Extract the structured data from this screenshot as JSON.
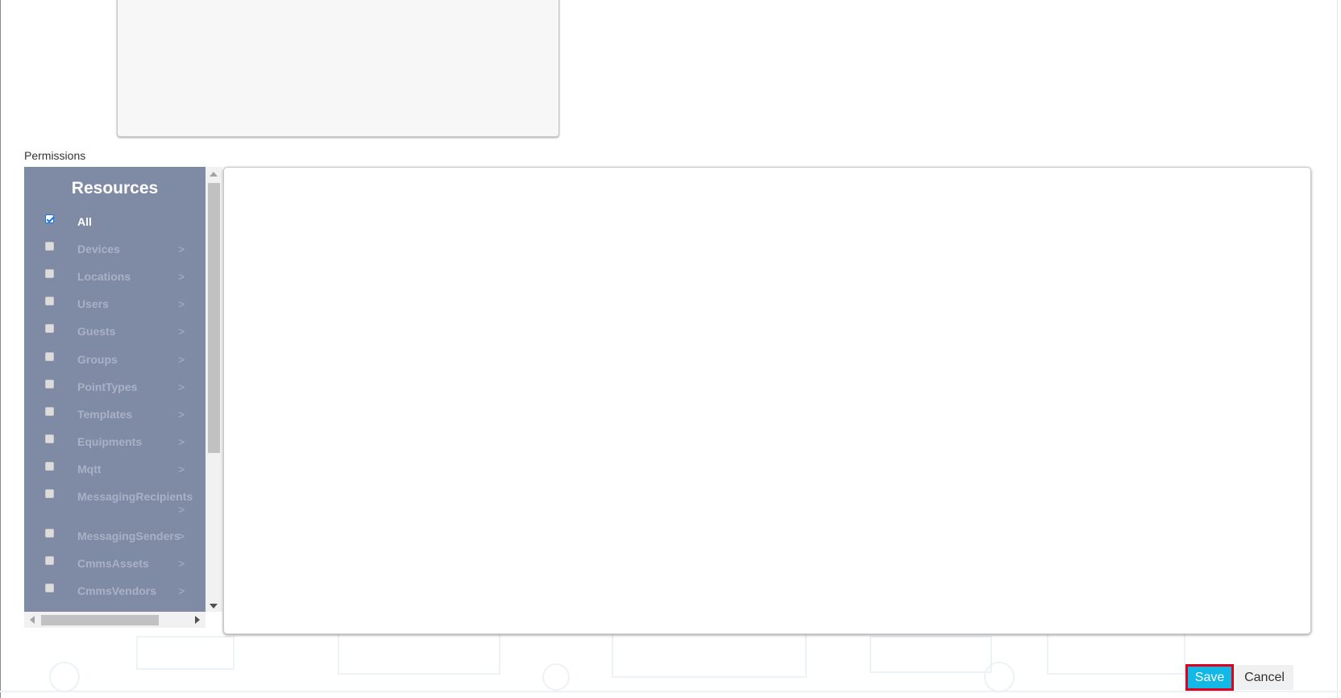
{
  "permissions_label": "Permissions",
  "resources": {
    "title": "Resources",
    "items": [
      {
        "label": "All",
        "checked": true,
        "arrow": ""
      },
      {
        "label": "Devices",
        "checked": false,
        "arrow": ">"
      },
      {
        "label": "Locations",
        "checked": false,
        "arrow": ">"
      },
      {
        "label": "Users",
        "checked": false,
        "arrow": ">"
      },
      {
        "label": "Guests",
        "checked": false,
        "arrow": ">"
      },
      {
        "label": "Groups",
        "checked": false,
        "arrow": ">"
      },
      {
        "label": "PointTypes",
        "checked": false,
        "arrow": ">"
      },
      {
        "label": "Templates",
        "checked": false,
        "arrow": ">"
      },
      {
        "label": "Equipments",
        "checked": false,
        "arrow": ">"
      },
      {
        "label": "Mqtt",
        "checked": false,
        "arrow": ">"
      },
      {
        "label": "MessagingRecipients",
        "checked": false,
        "arrow": ">"
      },
      {
        "label": "MessagingSenders",
        "checked": false,
        "arrow": ">"
      },
      {
        "label": "CmmsAssets",
        "checked": false,
        "arrow": ">"
      },
      {
        "label": "CmmsVendors",
        "checked": false,
        "arrow": ">"
      }
    ]
  },
  "footer": {
    "save_label": "Save",
    "cancel_label": "Cancel"
  },
  "colors": {
    "resources_bg": "#7f8aa5",
    "save_bg": "#12b8e6",
    "save_highlight_border": "#e0001b"
  }
}
